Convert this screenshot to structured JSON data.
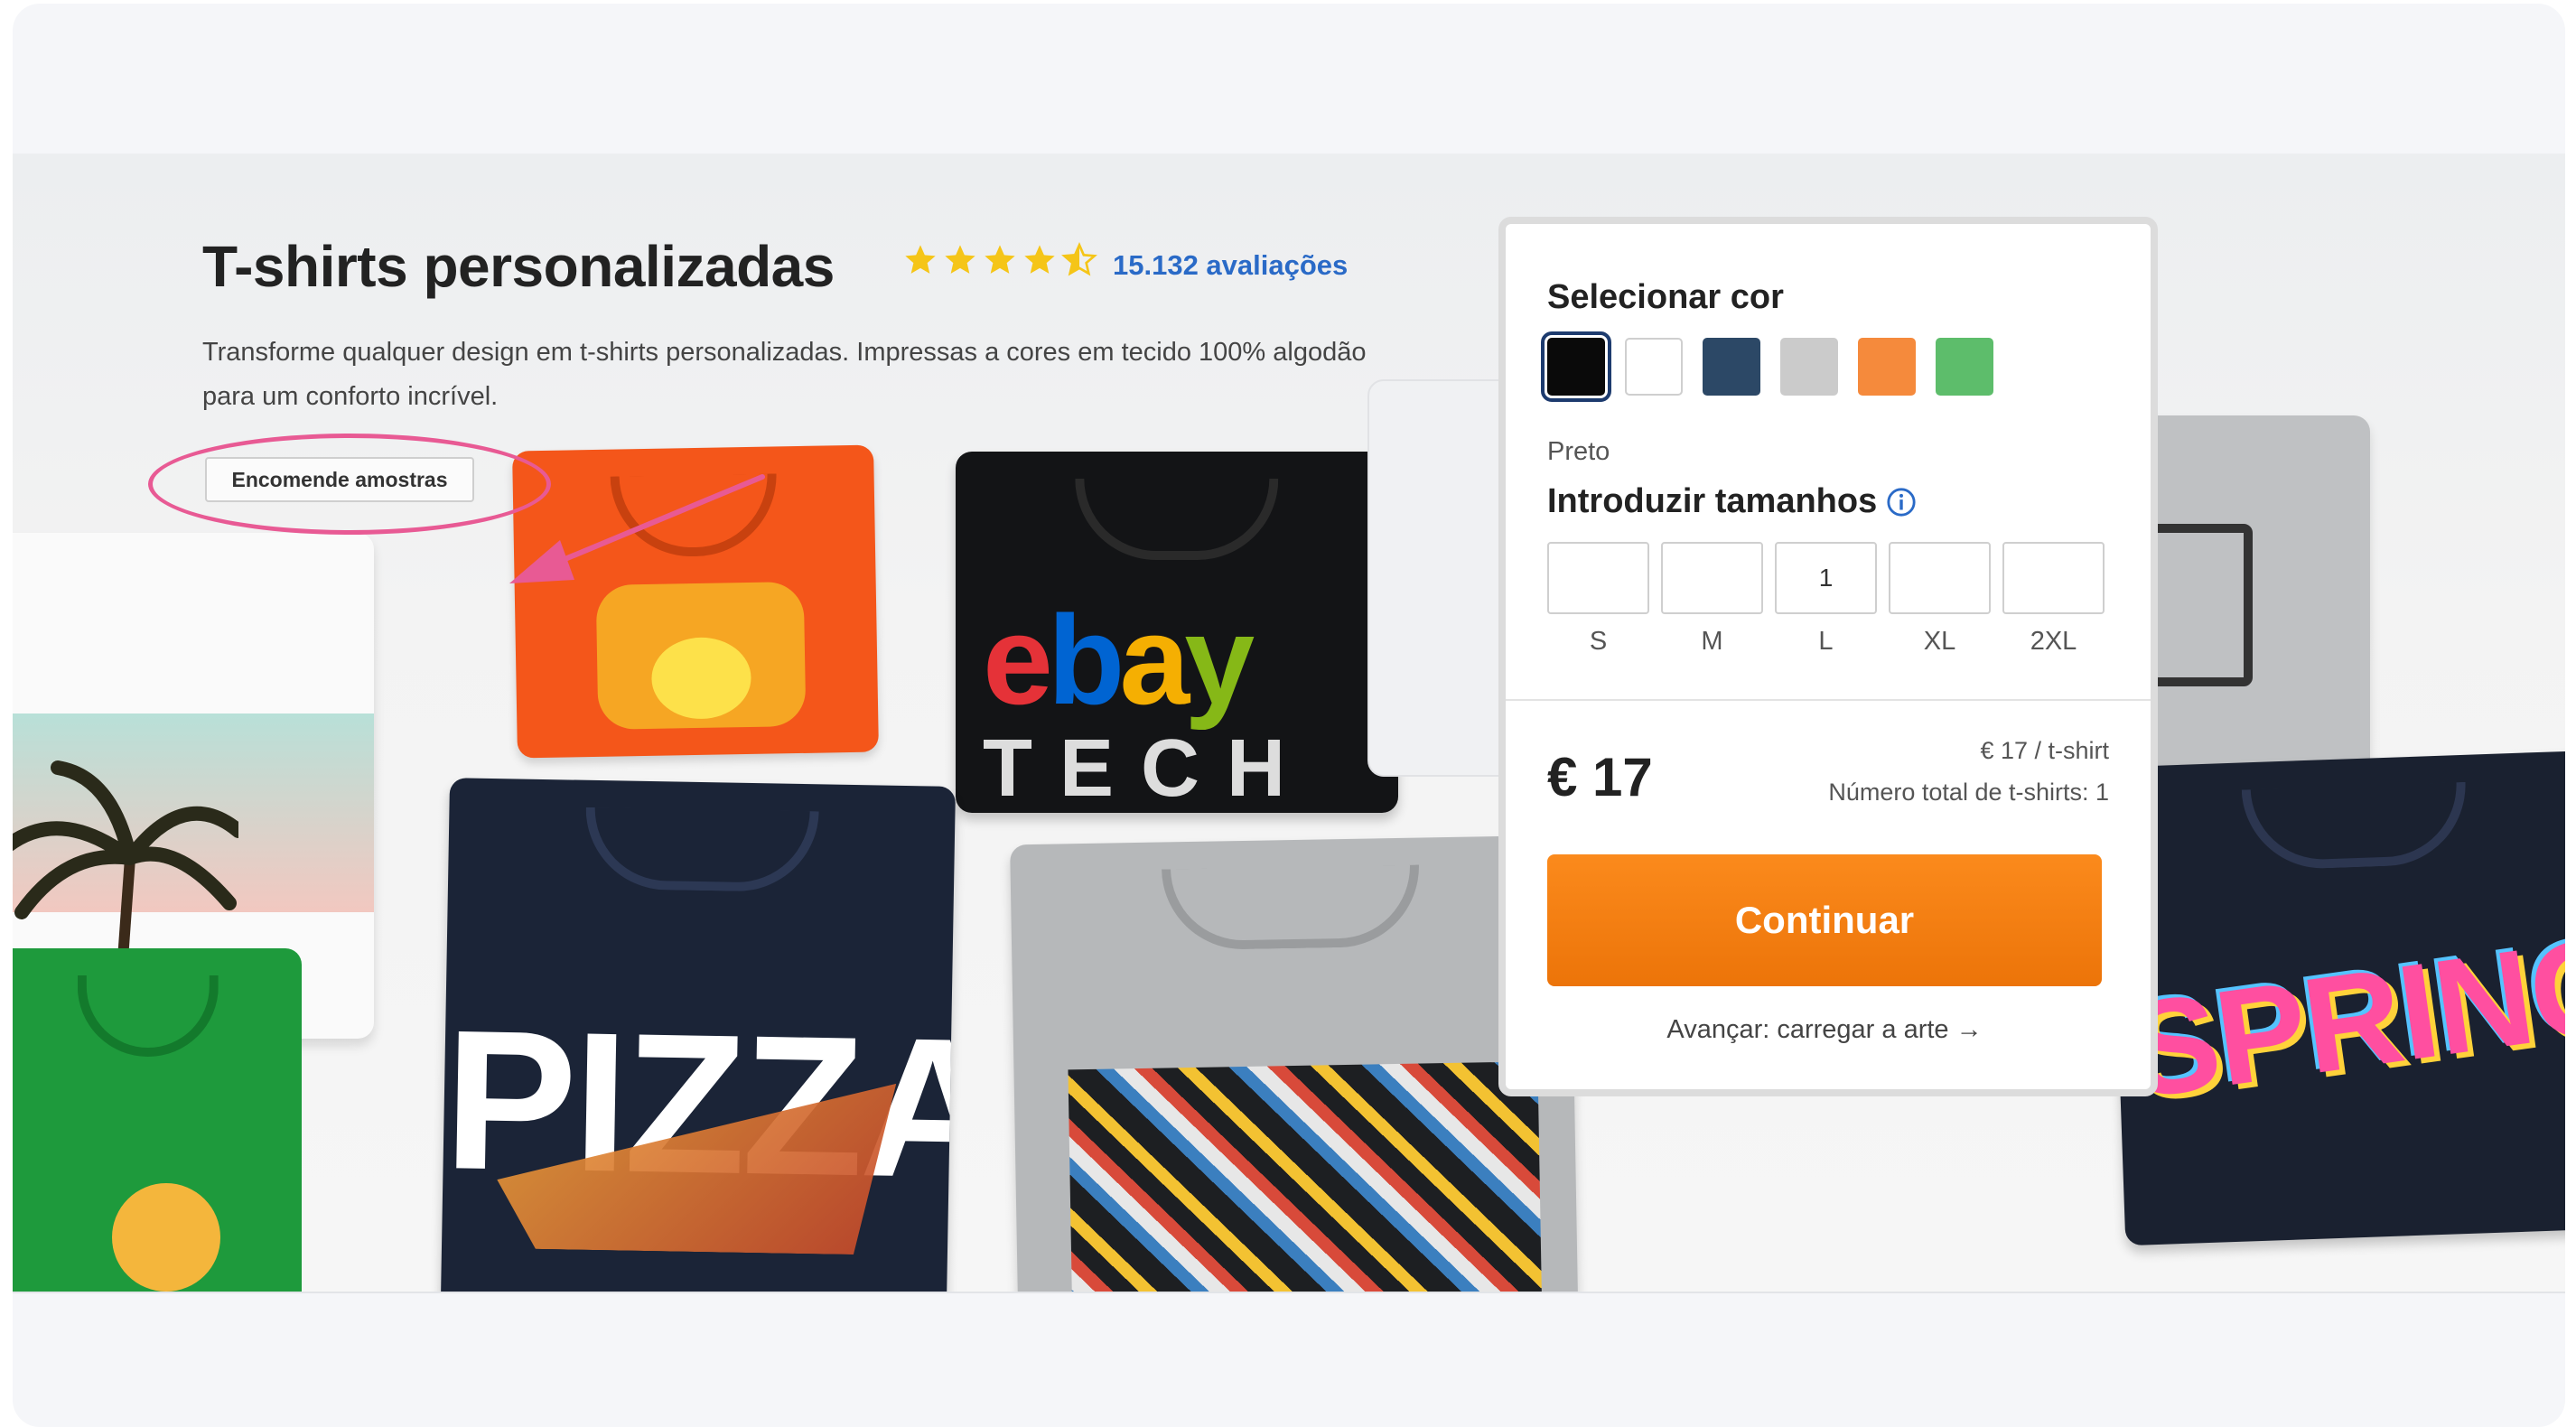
{
  "hero": {
    "title": "T-shirts personalizadas",
    "rating": {
      "value": 4.5,
      "max": 5
    },
    "reviews_link": "15.132 avaliações",
    "description": "Transforme qualquer design em t-shirts personalizadas. Impressas a cores em tecido 100% algodão para um conforto incrível.",
    "sample_button": "Encomende amostras"
  },
  "shirts": {
    "ebay": "ebay",
    "tech": "TECH",
    "pizza": "PIZZA",
    "spring": "SPRING"
  },
  "config": {
    "select_color_label": "Selecionar cor",
    "colors": [
      {
        "name": "Preto",
        "hex": "#0a0a0a",
        "selected": true
      },
      {
        "name": "white",
        "hex": "#ffffff",
        "selected": false
      },
      {
        "name": "navy",
        "hex": "#2c4866",
        "selected": false
      },
      {
        "name": "grey",
        "hex": "#cbcbcb",
        "selected": false
      },
      {
        "name": "orange",
        "hex": "#f58a3c",
        "selected": false
      },
      {
        "name": "green",
        "hex": "#5dbd6b",
        "selected": false
      }
    ],
    "selected_color_name": "Preto",
    "sizes_label": "Introduzir tamanhos",
    "sizes": [
      {
        "label": "S",
        "value": ""
      },
      {
        "label": "M",
        "value": ""
      },
      {
        "label": "L",
        "value": "1"
      },
      {
        "label": "XL",
        "value": ""
      },
      {
        "label": "2XL",
        "value": ""
      }
    ],
    "price": "€ 17",
    "unit_price": "€ 17 / t-shirt",
    "total_count": "Número total de t-shirts: 1",
    "continue_button": "Continuar",
    "next_link": "Avançar: carregar a arte →"
  },
  "colors": {
    "accent_orange": "#f07a0f",
    "link_blue": "#2a6ac7",
    "star_yellow": "#f5c518",
    "highlight_pink": "#e85a94"
  }
}
